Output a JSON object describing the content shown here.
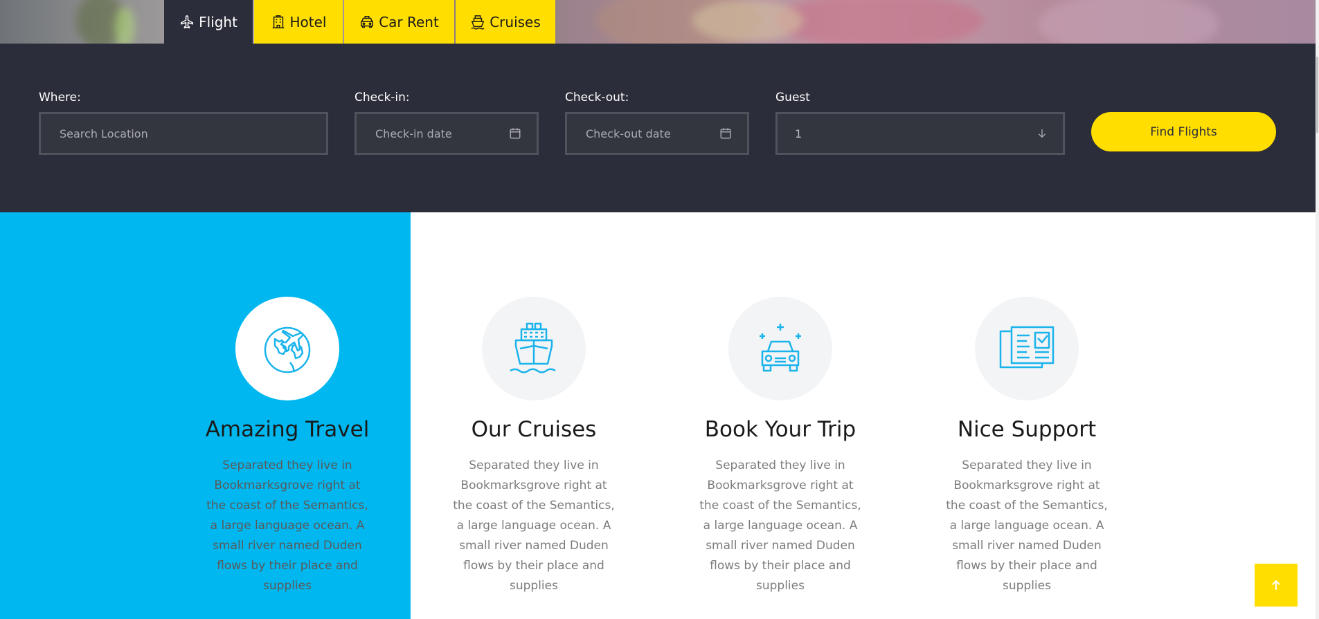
{
  "tabs": [
    {
      "label": "Flight",
      "icon": "plane-icon"
    },
    {
      "label": "Hotel",
      "icon": "hotel-icon"
    },
    {
      "label": "Car Rent",
      "icon": "taxi-icon"
    },
    {
      "label": "Cruises",
      "icon": "ship-icon"
    }
  ],
  "search": {
    "where_label": "Where:",
    "where_placeholder": "Search Location",
    "checkin_label": "Check-in:",
    "checkin_placeholder": "Check-in date",
    "checkout_label": "Check-out:",
    "checkout_placeholder": "Check-out date",
    "guest_label": "Guest",
    "guest_value": "1",
    "submit_label": "Find Flights"
  },
  "features": [
    {
      "title": "Amazing Travel",
      "text": "Separated they live in Bookmarksgrove right at the coast of the Semantics, a large language ocean. A small river named Duden flows by their place and supplies",
      "icon": "globe-plane-icon"
    },
    {
      "title": "Our Cruises",
      "text": "Separated they live in Bookmarksgrove right at the coast of the Semantics, a large language ocean. A small river named Duden flows by their place and supplies",
      "icon": "cruise-ship-icon"
    },
    {
      "title": "Book Your Trip",
      "text": "Separated they live in Bookmarksgrove right at the coast of the Semantics, a large language ocean. A small river named Duden flows by their place and supplies",
      "icon": "car-icon"
    },
    {
      "title": "Nice Support",
      "text": "Separated they live in Bookmarksgrove right at the coast of the Semantics, a large language ocean. A small river named Duden flows by their place and supplies",
      "icon": "brochure-icon"
    }
  ],
  "colors": {
    "accent": "#ffde00",
    "dark_band": "#2c2d3a",
    "blue_panel": "#00b7ef",
    "icon_blue": "#1ab3ec"
  }
}
